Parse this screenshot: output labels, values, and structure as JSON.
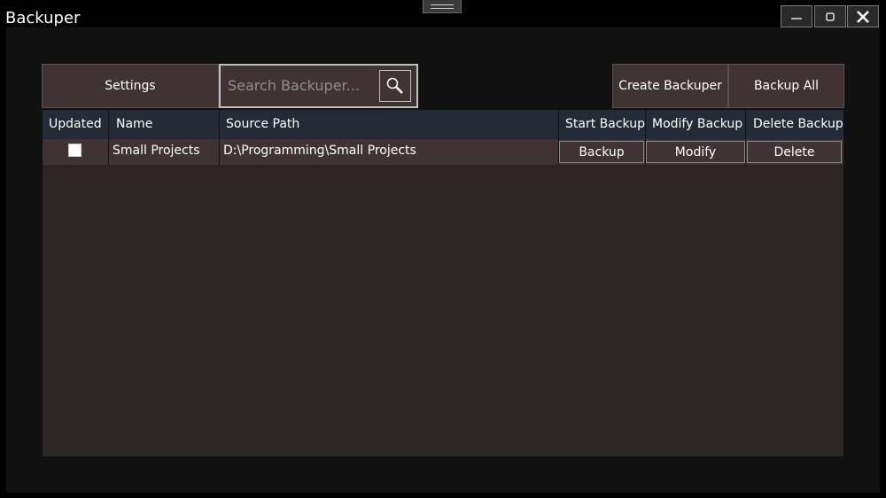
{
  "window": {
    "title": "Backuper",
    "minimize_icon": "minimize-icon",
    "maximize_icon": "maximize-icon",
    "close_icon": "close-icon"
  },
  "toolbar": {
    "settings_label": "Settings",
    "search_placeholder": "Search Backuper...",
    "search_icon": "search-icon",
    "create_label": "Create Backuper",
    "backup_all_label": "Backup All"
  },
  "table": {
    "columns": [
      "Updated",
      "Name",
      "Source Path",
      "Start Backup",
      "Modify Backup",
      "Delete Backup"
    ],
    "rows": [
      {
        "updated": false,
        "name": "Small Projects",
        "source_path": "D:\\Programming\\Small Projects",
        "backup_label": "Backup",
        "modify_label": "Modify",
        "delete_label": "Delete"
      }
    ]
  },
  "colors": {
    "window_bg": "#111111",
    "button_bg": "#3f3334",
    "grid_bg": "#2c2425",
    "header_bg": "#232c36"
  }
}
